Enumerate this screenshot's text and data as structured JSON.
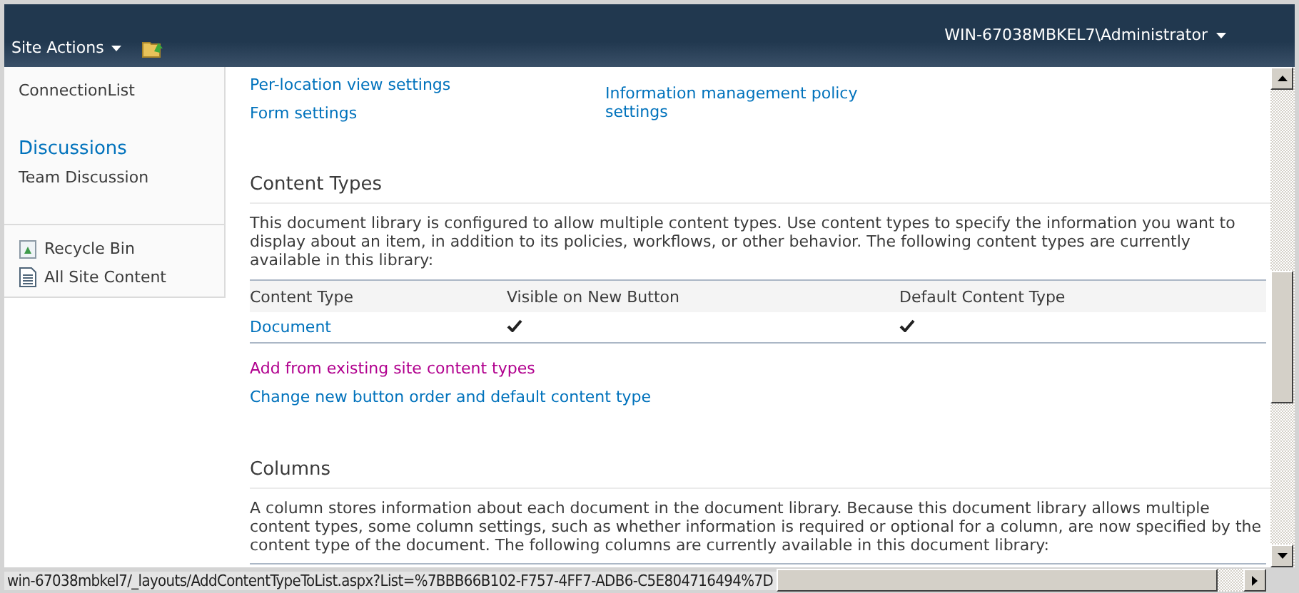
{
  "top_bar": {
    "site_actions": "Site Actions",
    "user": "WIN-67038MBKEL7\\Administrator"
  },
  "sidebar": {
    "items": [
      {
        "label": "ConnectionList",
        "kind": "item"
      },
      {
        "label": "Discussions",
        "kind": "heading"
      },
      {
        "label": "Team Discussion",
        "kind": "item"
      }
    ],
    "bottom_links": [
      {
        "label": "Recycle Bin",
        "kind": "recycle"
      },
      {
        "label": "All Site Content",
        "kind": "content"
      }
    ]
  },
  "settings_links": {
    "left": [
      "Per-location view settings",
      "Form settings"
    ],
    "right": [
      "Information management policy settings"
    ]
  },
  "content_types": {
    "heading": "Content Types",
    "description": "This document library is configured to allow multiple content types. Use content types to specify the information you want to display about an item, in addition to its policies, workflows, or other behavior. The following content types are currently available in this library:",
    "columns": [
      "Content Type",
      "Visible on New Button",
      "Default Content Type"
    ],
    "rows": [
      {
        "name": "Document",
        "visible": true,
        "default": true
      }
    ],
    "links": [
      {
        "label": "Add from existing site content types",
        "visited": true
      },
      {
        "label": "Change new button order and default content type",
        "visited": false
      }
    ]
  },
  "columns_section": {
    "heading": "Columns",
    "description": "A column stores information about each document in the document library. Because this document library allows multiple content types, some column settings, such as whether information is required or optional for a column, are now specified by the content type of the document. The following columns are currently available in this document library:"
  },
  "status_bar": {
    "url": "win-67038mbkel7/_layouts/AddContentTypeToList.aspx?List=%7BBB66B102-F757-4FF7-ADB6-C5E804716494%7D"
  }
}
